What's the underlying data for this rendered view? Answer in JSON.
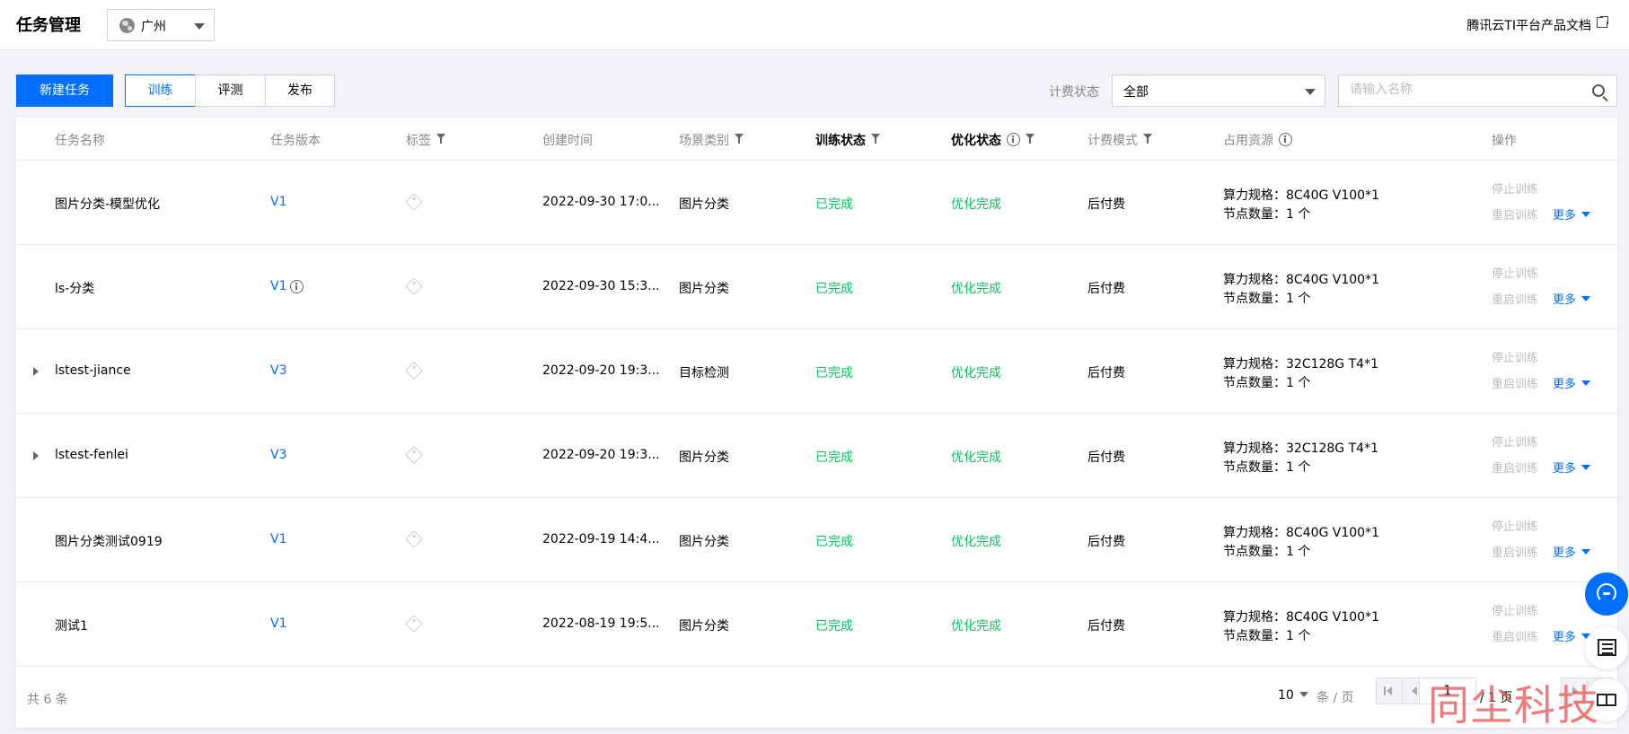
{
  "header": {
    "title": "任务管理",
    "region": "广州",
    "docs_link": "腾讯云TI平台产品文档"
  },
  "toolbar": {
    "new_task": "新建任务",
    "tabs": [
      {
        "label": "训练",
        "active": true
      },
      {
        "label": "评测",
        "active": false
      },
      {
        "label": "发布",
        "active": false
      }
    ],
    "billing_label": "计费状态",
    "billing_value": "全部",
    "search_placeholder": "请输入名称"
  },
  "table": {
    "columns": [
      "任务名称",
      "任务版本",
      "标签",
      "创建时间",
      "场景类别",
      "训练状态",
      "优化状态",
      "计费模式",
      "占用资源",
      "操作"
    ],
    "rows": [
      {
        "name": "图片分类-模型优化",
        "version": "V1",
        "created": "2022-09-30 17:0...",
        "scene": "图片分类",
        "train_status": "已完成",
        "opt_status": "优化完成",
        "billing": "后付费",
        "spec": "算力规格：8C40G V100*1",
        "nodes": "节点数量：1 个",
        "expandable": false,
        "version_info": false
      },
      {
        "name": "ls-分类",
        "version": "V1",
        "created": "2022-09-30 15:3...",
        "scene": "图片分类",
        "train_status": "已完成",
        "opt_status": "优化完成",
        "billing": "后付费",
        "spec": "算力规格：8C40G V100*1",
        "nodes": "节点数量：1 个",
        "expandable": false,
        "version_info": true
      },
      {
        "name": "lstest-jiance",
        "version": "V3",
        "created": "2022-09-20 19:3...",
        "scene": "目标检测",
        "train_status": "已完成",
        "opt_status": "优化完成",
        "billing": "后付费",
        "spec": "算力规格：32C128G T4*1",
        "nodes": "节点数量：1 个",
        "expandable": true,
        "version_info": false
      },
      {
        "name": "lstest-fenlei",
        "version": "V3",
        "created": "2022-09-20 19:3...",
        "scene": "图片分类",
        "train_status": "已完成",
        "opt_status": "优化完成",
        "billing": "后付费",
        "spec": "算力规格：32C128G T4*1",
        "nodes": "节点数量：1 个",
        "expandable": true,
        "version_info": false
      },
      {
        "name": "图片分类测试0919",
        "version": "V1",
        "created": "2022-09-19 14:4...",
        "scene": "图片分类",
        "train_status": "已完成",
        "opt_status": "优化完成",
        "billing": "后付费",
        "spec": "算力规格：8C40G V100*1",
        "nodes": "节点数量：1 个",
        "expandable": false,
        "version_info": false
      },
      {
        "name": "测试1",
        "version": "V1",
        "created": "2022-08-19 19:5...",
        "scene": "图片分类",
        "train_status": "已完成",
        "opt_status": "优化完成",
        "billing": "后付费",
        "spec": "算力规格：8C40G V100*1",
        "nodes": "节点数量：1 个",
        "expandable": false,
        "version_info": false
      }
    ],
    "actions": {
      "stop": "停止训练",
      "restart": "重启训练",
      "more": "更多"
    }
  },
  "pagination": {
    "total": "共 6 条",
    "page_size": "10",
    "per_page": "条 / 页",
    "current_page": "1",
    "total_pages": "/ 1 页"
  },
  "watermark": "同尘科技",
  "colors": {
    "primary": "#006eff",
    "success": "#0abf5b",
    "disabled": "#bbbbbb"
  }
}
